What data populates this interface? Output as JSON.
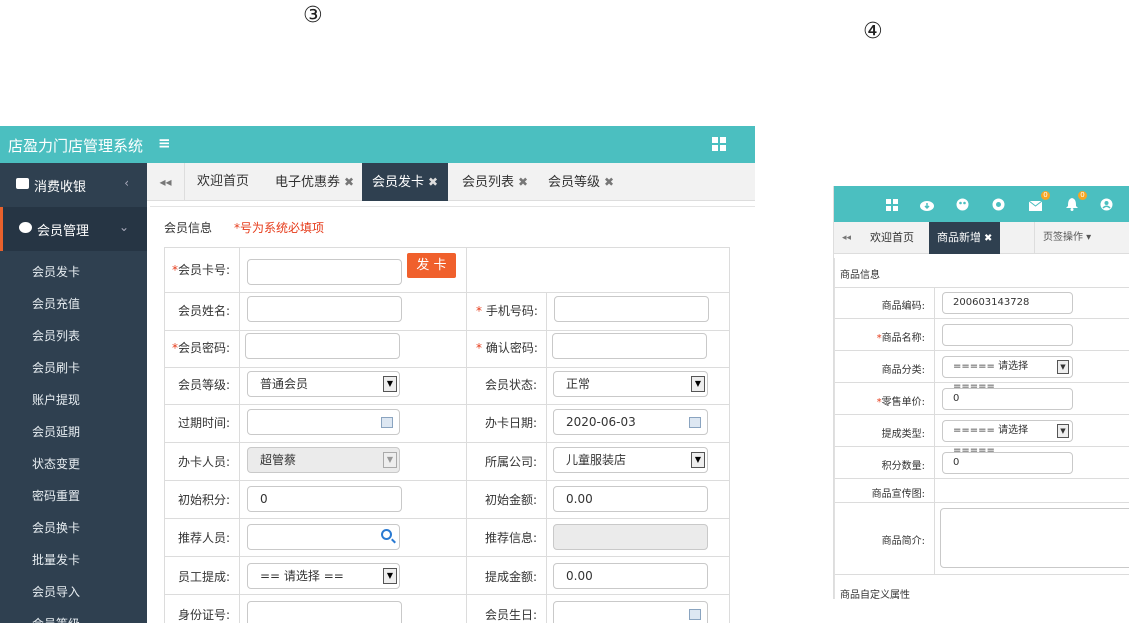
{
  "markers": {
    "panel3": "③",
    "panel4": "④"
  },
  "panel3": {
    "app_title": "店盈力门店管理系统",
    "menu_toggle": "≡",
    "sidebar": {
      "top_items": [
        {
          "label": "消费收银",
          "chevron": "‹"
        },
        {
          "label": "会员管理",
          "chevron": "⌄"
        }
      ],
      "sub_items": [
        "会员发卡",
        "会员充值",
        "会员列表",
        "会员刷卡",
        "账户提现",
        "会员延期",
        "状态变更",
        "密码重置",
        "会员换卡",
        "批量发卡",
        "会员导入",
        "会员等级"
      ]
    },
    "tabs": [
      {
        "label": "欢迎首页",
        "closable": false
      },
      {
        "label": "电子优惠券",
        "closable": true
      },
      {
        "label": "会员发卡",
        "closable": true,
        "active": true
      },
      {
        "label": "会员列表",
        "closable": true
      },
      {
        "label": "会员等级",
        "closable": true
      }
    ],
    "tab_back": "◂◂",
    "close_glyph": "✖",
    "section_label": "会员信息",
    "required_note": "*号为系统必填项",
    "issue_button": "发 卡",
    "form": {
      "card_no": {
        "label": "会员卡号:",
        "req": "*",
        "value": ""
      },
      "name": {
        "label": "会员姓名:",
        "value": ""
      },
      "phone": {
        "label": "手机号码:",
        "req": "* ",
        "value": ""
      },
      "password": {
        "label": "会员密码:",
        "req": "*",
        "value": ""
      },
      "confirm_password": {
        "label": "确认密码:",
        "req": "* ",
        "value": ""
      },
      "level": {
        "label": "会员等级:",
        "value": "普通会员"
      },
      "status": {
        "label": "会员状态:",
        "value": "正常"
      },
      "expire": {
        "label": "过期时间:",
        "value": ""
      },
      "issue_date": {
        "label": "办卡日期:",
        "value": "2020-06-03"
      },
      "staff": {
        "label": "办卡人员:",
        "value": "超管蔡"
      },
      "company": {
        "label": "所属公司:",
        "value": "儿童服装店"
      },
      "init_points": {
        "label": "初始积分:",
        "value": "0"
      },
      "init_amount": {
        "label": "初始金额:",
        "value": "0.00"
      },
      "referrer": {
        "label": "推荐人员:",
        "value": ""
      },
      "referrer_info": {
        "label": "推荐信息:",
        "value": ""
      },
      "commission": {
        "label": "员工提成:",
        "value": "== 请选择 =="
      },
      "commission_amount": {
        "label": "提成金额:",
        "value": "0.00"
      },
      "id_card": {
        "label": "身份证号:",
        "value": ""
      },
      "birthday": {
        "label": "会员生日:",
        "value": ""
      }
    }
  },
  "panel4": {
    "header_icons": [
      "grid-icon",
      "cloud-download-icon",
      "palette-icon",
      "settings-icon",
      "mail-icon",
      "bell-icon",
      "user-icon"
    ],
    "badges": {
      "mail": "0",
      "bell": "0"
    },
    "tab_back": "◂◂",
    "tabs": [
      {
        "label": "欢迎首页"
      },
      {
        "label": "商品新增",
        "active": true,
        "close": "✖"
      }
    ],
    "tab_ops": "页签操作 ▾",
    "section_product": "商品信息",
    "section_custom": "商品自定义属性",
    "fields": {
      "code": {
        "label": "商品编码:",
        "value": "200603143728"
      },
      "name": {
        "label": "商品名称:",
        "req": "*",
        "value": ""
      },
      "category": {
        "label": "商品分类:",
        "value": "===== 请选择 ====="
      },
      "price": {
        "label": "零售单价:",
        "req": "*",
        "value": "0"
      },
      "commission_type": {
        "label": "提成类型:",
        "value": "===== 请选择 ====="
      },
      "points": {
        "label": "积分数量:",
        "value": "0"
      },
      "promo_image": {
        "label": "商品宣传图:"
      },
      "intro": {
        "label": "商品简介:",
        "value": ""
      }
    }
  }
}
